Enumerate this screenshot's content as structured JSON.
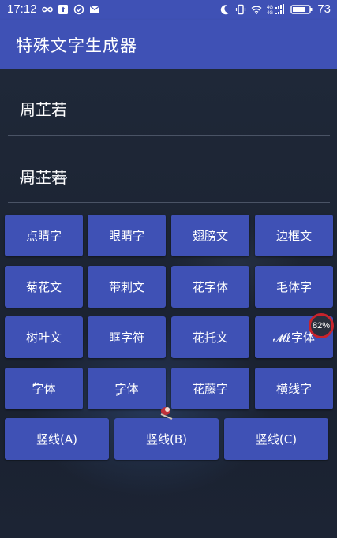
{
  "status_bar": {
    "time": "17:12",
    "battery": "73",
    "signal_label": "4G"
  },
  "app_bar": {
    "title": "特殊文字生成器"
  },
  "input": {
    "text": "周芷若"
  },
  "output": {
    "text": "周芷若"
  },
  "buttons": {
    "row1": [
      "点睛字",
      "眼睛字",
      "翅膀文",
      "边框文"
    ],
    "row2": [
      "菊花文",
      "带刺文",
      "花字体",
      "毛体字"
    ],
    "row3": [
      "树叶文",
      "眶字符",
      "花托文",
      "𝓜ℓ字体"
    ],
    "row4": [
      "ٌٌ字体",
      "ٍٍ字体",
      "花藤字",
      "横线字"
    ],
    "row5": [
      "竖线(A)",
      "竖线(B)",
      "竖线(C)"
    ]
  },
  "floating_badge": {
    "percent": "82%"
  },
  "colors": {
    "primary": "#3f51b5",
    "background": "#1d2535",
    "badge_ring": "#c8232c"
  }
}
